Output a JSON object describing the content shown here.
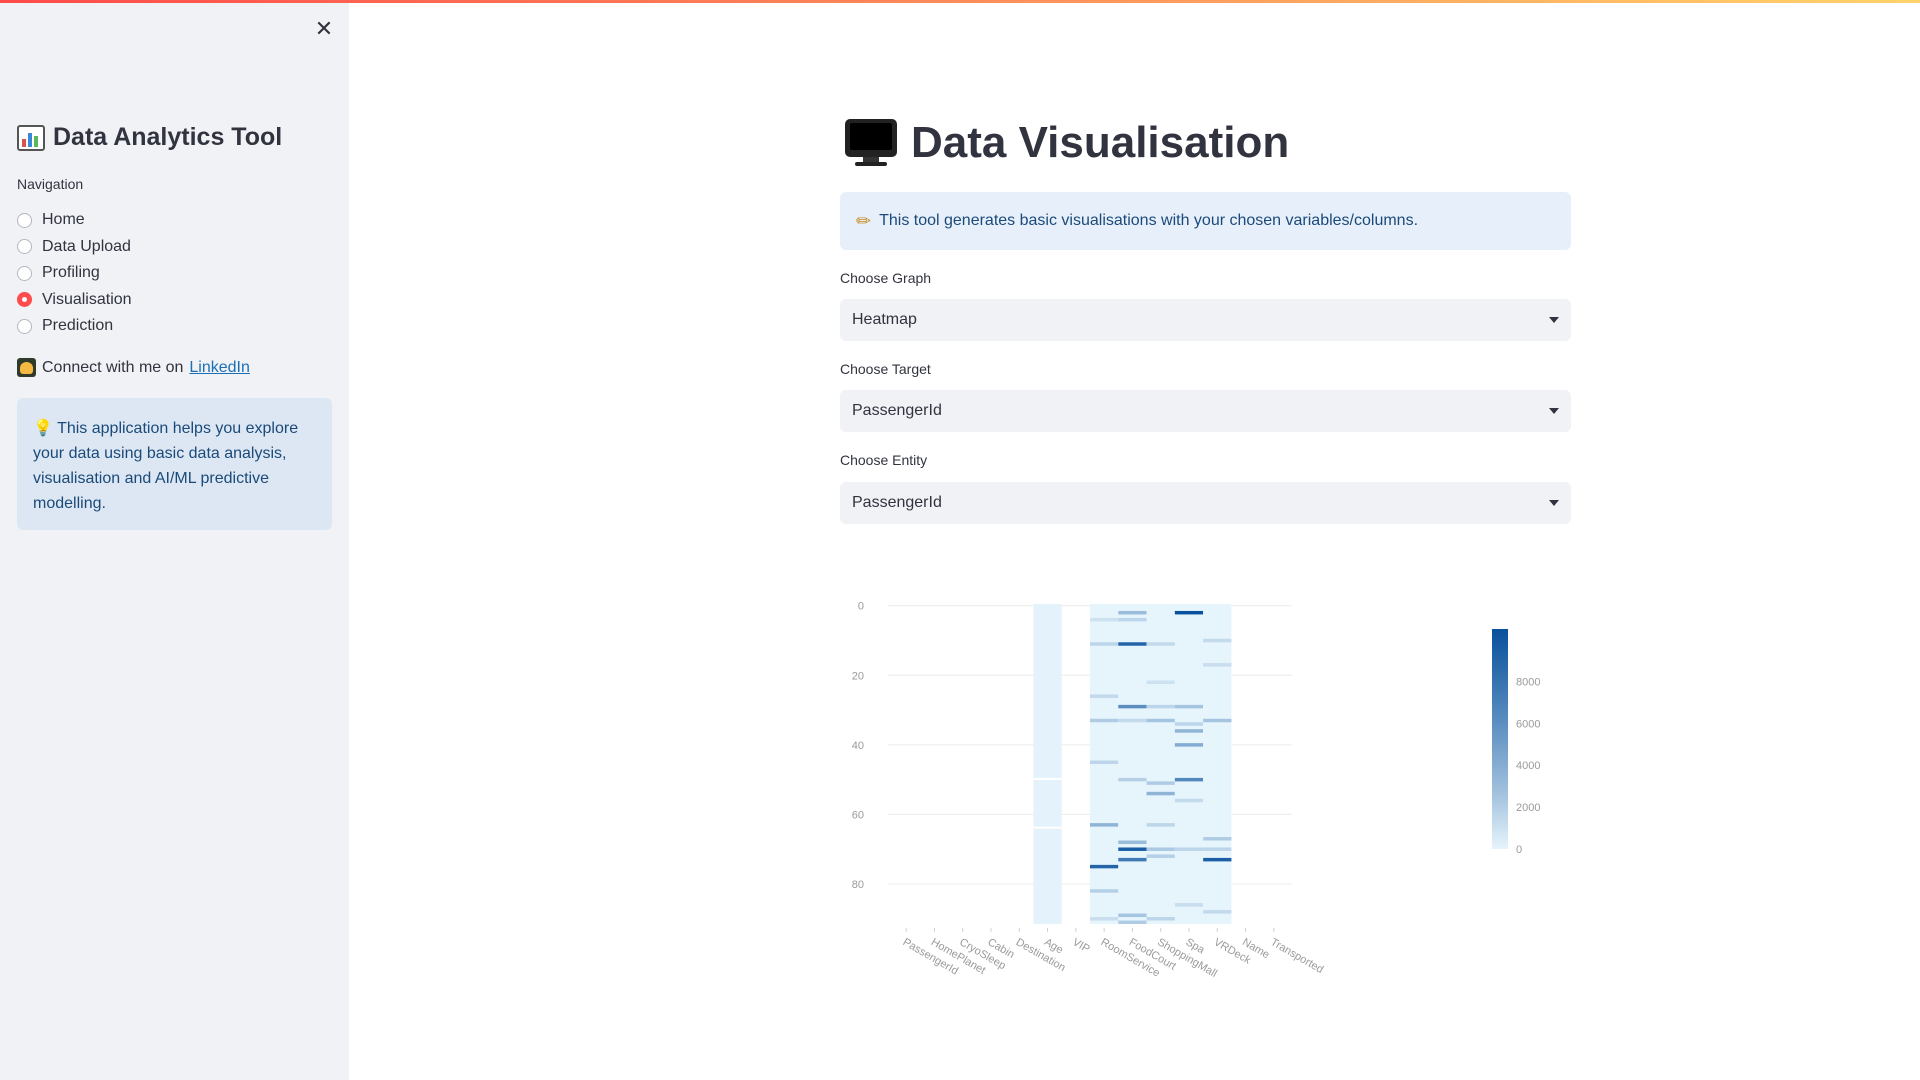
{
  "sidebar": {
    "close_icon": "close-icon",
    "app_title": "Data Analytics Tool",
    "app_icon": "bar-chart-icon",
    "nav_label": "Navigation",
    "nav_items": [
      {
        "label": "Home",
        "selected": false
      },
      {
        "label": "Data Upload",
        "selected": false
      },
      {
        "label": "Profiling",
        "selected": false
      },
      {
        "label": "Visualisation",
        "selected": true
      },
      {
        "label": "Prediction",
        "selected": false
      }
    ],
    "connect_text": "Connect with me on",
    "connect_link": "LinkedIn",
    "info_text": "This application helps you explore your data using basic data analysis, visualisation and AI/ML predictive modelling."
  },
  "main": {
    "title": "Data Visualisation",
    "title_icon": "monitor-icon",
    "tip": "This tool generates basic visualisations with your chosen variables/columns.",
    "graph_label": "Choose Graph",
    "graph_value": "Heatmap",
    "target_label": "Choose Target",
    "target_value": "PassengerId",
    "entity_label": "Choose Entity",
    "entity_value": "PassengerId"
  },
  "colors": {
    "accent": "#ff4b4b",
    "sidebar_bg": "#f0f2f6",
    "info_bg": "#dce7f3",
    "heat_low": "#e6f4fc",
    "heat_high": "#08519c"
  },
  "chart_data": {
    "type": "heatmap",
    "columns": [
      "PassengerId",
      "HomePlanet",
      "CryoSleep",
      "Cabin",
      "Destination",
      "Age",
      "VIP",
      "RoomService",
      "FoodCourt",
      "ShoppingMall",
      "Spa",
      "VRDeck",
      "Name",
      "Transported"
    ],
    "y_ticks": [
      0,
      20,
      40,
      60,
      80
    ],
    "rows": 92,
    "colorbar_ticks": [
      0,
      2000,
      4000,
      6000,
      8000
    ],
    "zmax": 10500,
    "grid": true,
    "columns_with_values": {
      "Age": {
        "base": 30,
        "gaps": [
          50,
          64
        ]
      },
      "RoomService": {
        "base": 0,
        "highlights": {
          "4": 800,
          "11": 1500,
          "26": 1200,
          "33": 2000,
          "45": 1500,
          "63": 3500,
          "75": 9000,
          "82": 1800,
          "90": 1000
        }
      },
      "FoodCourt": {
        "base": 0,
        "highlights": {
          "2": 3000,
          "4": 1500,
          "11": 9000,
          "29": 6000,
          "33": 1200,
          "50": 1800,
          "68": 3000,
          "70": 9500,
          "73": 7500,
          "89": 2500,
          "91": 2000
        }
      },
      "ShoppingMall": {
        "base": 0,
        "highlights": {
          "11": 1200,
          "22": 800,
          "29": 1500,
          "33": 2500,
          "51": 2000,
          "54": 3500,
          "63": 1500,
          "70": 2200,
          "72": 1800,
          "90": 1500
        }
      },
      "Spa": {
        "base": 0,
        "highlights": {
          "2": 10500,
          "29": 2500,
          "34": 1500,
          "36": 3500,
          "40": 4000,
          "50": 6500,
          "56": 1200,
          "70": 1500,
          "86": 1000
        }
      },
      "VRDeck": {
        "base": 0,
        "highlights": {
          "10": 1200,
          "17": 1000,
          "33": 2500,
          "67": 2000,
          "70": 1500,
          "73": 9500,
          "88": 1200
        }
      }
    }
  }
}
